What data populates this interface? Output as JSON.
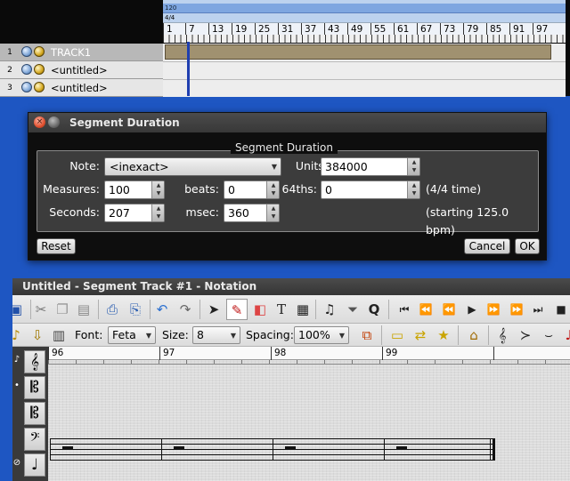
{
  "track_editor": {
    "tempo": "120",
    "time_signature": "4/4",
    "bar_numbers": [
      "1",
      "7",
      "13",
      "19",
      "25",
      "31",
      "37",
      "43",
      "49",
      "55",
      "61",
      "67",
      "73",
      "79",
      "85",
      "91",
      "97"
    ],
    "tracks": [
      {
        "number": "1",
        "name": "TRACK1",
        "selected": true
      },
      {
        "number": "2",
        "name": "<untitled>",
        "selected": false
      },
      {
        "number": "3",
        "name": "<untitled>",
        "selected": false
      }
    ]
  },
  "dialog": {
    "title": "Segment Duration",
    "group_title": "Segment Duration",
    "note_label": "Note:",
    "note_value": "<inexact>",
    "units_label": "Units:",
    "units_value": "384000",
    "measures_label": "Measures:",
    "measures_value": "100",
    "beats_label": "beats:",
    "beats_value": "0",
    "sixtyfourths_label": "64ths:",
    "sixtyfourths_value": "0",
    "time_info": "(4/4 time)",
    "seconds_label": "Seconds:",
    "seconds_value": "207",
    "msec_label": "msec:",
    "msec_value": "360",
    "tempo_info": "(starting 125.0 bpm)",
    "reset_label": "Reset",
    "cancel_label": "Cancel",
    "ok_label": "OK"
  },
  "notation": {
    "title": "Untitled - Segment Track #1 - Notation",
    "font_label": "Font:",
    "font_value": "Feta",
    "size_label": "Size:",
    "size_value": "8",
    "spacing_label": "Spacing:",
    "spacing_value": "100%",
    "bar_numbers": [
      "96",
      "97",
      "98",
      "99"
    ]
  },
  "colors": {
    "desktop": "#1e56c2",
    "segment": "#a09170",
    "playhead": "#1f3fb0"
  }
}
